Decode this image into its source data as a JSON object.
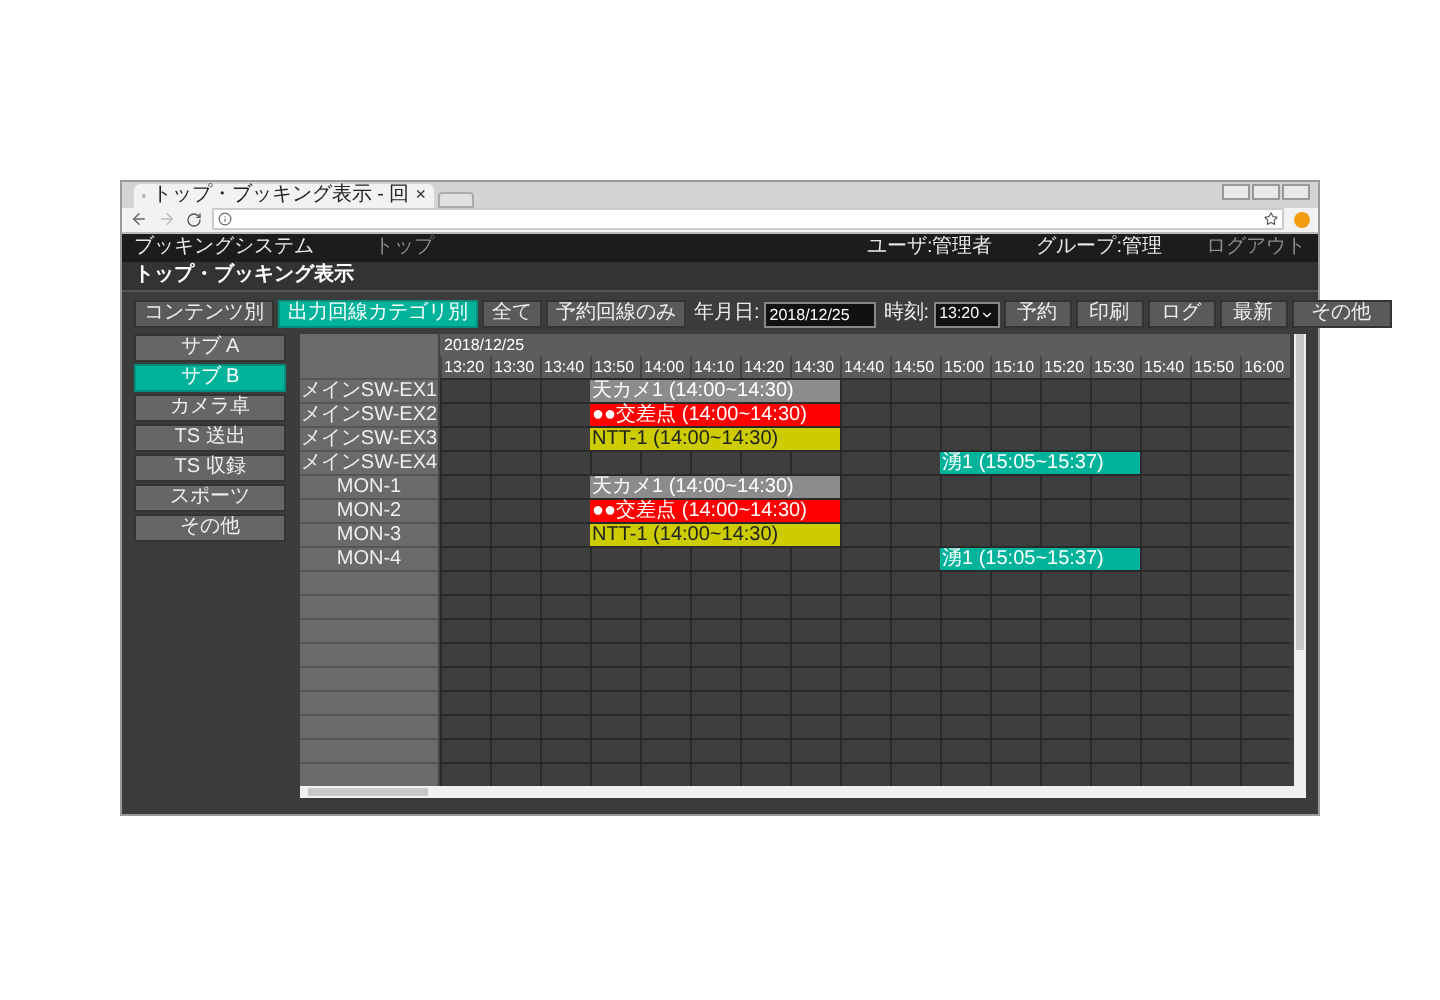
{
  "browser": {
    "tab_title": "トップ・ブッキング表示 - 回",
    "tab_close": "×"
  },
  "nav": {
    "app_name": "ブッキングシステム",
    "link": "トップ",
    "user": "ユーザ:管理者",
    "group": "グループ:管理",
    "logout": "ログアウト"
  },
  "page_title": "トップ・ブッキング表示",
  "toolbar": {
    "view_tabs": [
      {
        "label": "コンテンツ別",
        "selected": false
      },
      {
        "label": "出力回線カテゴリ別",
        "selected": true
      },
      {
        "label": "全て",
        "selected": false
      },
      {
        "label": "予約回線のみ",
        "selected": false
      }
    ],
    "date_label": "年月日:",
    "date_value": "2018/12/25",
    "time_label": "時刻:",
    "time_value": "13:20",
    "actions": [
      "予約",
      "印刷",
      "ログ",
      "最新",
      "その他"
    ]
  },
  "sidebar": {
    "items": [
      {
        "label": "サブ A",
        "selected": false
      },
      {
        "label": "サブ B",
        "selected": true
      },
      {
        "label": "カメラ卓",
        "selected": false
      },
      {
        "label": "TS 送出",
        "selected": false
      },
      {
        "label": "TS 収録",
        "selected": false
      },
      {
        "label": "スポーツ",
        "selected": false
      },
      {
        "label": "その他",
        "selected": false
      }
    ]
  },
  "schedule": {
    "date": "2018/12/25",
    "times": [
      "13:20",
      "13:30",
      "13:40",
      "13:50",
      "14:00",
      "14:10",
      "14:20",
      "14:30",
      "14:40",
      "14:50",
      "15:00",
      "15:10",
      "15:20",
      "15:30",
      "15:40",
      "15:50",
      "16:00"
    ],
    "rows": [
      {
        "name": "メインSW-EX1",
        "events": [
          {
            "title": "天カメ1 (14:00~14:30)",
            "color": "#8c8c8c"
          }
        ],
        "slots": [
          {
            "kind": "free"
          },
          {
            "kind": "free"
          },
          {
            "kind": "free"
          },
          {
            "kind": "booked"
          },
          {
            "kind": "booked"
          },
          {
            "kind": "booked"
          },
          {
            "kind": "booked"
          },
          {
            "kind": "booked"
          },
          {
            "kind": "free"
          },
          {
            "kind": "free"
          },
          {
            "kind": "free"
          },
          {
            "kind": "free"
          },
          {
            "kind": "free"
          },
          {
            "kind": "free"
          },
          {
            "kind": "free"
          },
          {
            "kind": "free"
          },
          {
            "kind": "free"
          }
        ]
      },
      {
        "name": "メインSW-EX2",
        "events": [
          {
            "title": "●●交差点 (14:00~14:30)",
            "color": "#ff0000"
          }
        ],
        "slots": [
          {
            "kind": "free"
          },
          {
            "kind": "free"
          },
          {
            "kind": "free"
          },
          {
            "kind": "booked"
          },
          {
            "kind": "booked"
          },
          {
            "kind": "booked"
          },
          {
            "kind": "booked"
          },
          {
            "kind": "booked"
          },
          {
            "kind": "free"
          },
          {
            "kind": "free"
          },
          {
            "kind": "free"
          },
          {
            "kind": "free"
          },
          {
            "kind": "free"
          },
          {
            "kind": "free"
          },
          {
            "kind": "free"
          },
          {
            "kind": "free"
          },
          {
            "kind": "free"
          }
        ]
      },
      {
        "name": "メインSW-EX3",
        "events": [
          {
            "title": "NTT-1 (14:00~14:30)",
            "color": "#cccc00"
          }
        ],
        "slots": [
          {
            "kind": "free"
          },
          {
            "kind": "free"
          },
          {
            "kind": "free"
          },
          {
            "kind": "booked"
          },
          {
            "kind": "booked"
          },
          {
            "kind": "booked"
          },
          {
            "kind": "booked"
          },
          {
            "kind": "booked"
          },
          {
            "kind": "free"
          },
          {
            "kind": "free"
          },
          {
            "kind": "free"
          },
          {
            "kind": "free"
          },
          {
            "kind": "free"
          },
          {
            "kind": "free"
          },
          {
            "kind": "free"
          },
          {
            "kind": "free"
          },
          {
            "kind": "free"
          }
        ]
      },
      {
        "name": "メインSW-EX4",
        "events": [
          {
            "title": "湧1 (15:05~15:37)",
            "color": "#00b39a"
          }
        ],
        "slots": [
          {
            "kind": "free"
          },
          {
            "kind": "free"
          },
          {
            "kind": "free"
          },
          {
            "kind": "free"
          },
          {
            "kind": "free"
          },
          {
            "kind": "free"
          },
          {
            "kind": "free"
          },
          {
            "kind": "free"
          },
          {
            "kind": "free"
          },
          {
            "kind": "free"
          },
          {
            "kind": "booked"
          },
          {
            "kind": "booked"
          },
          {
            "kind": "booked"
          },
          {
            "kind": "booked"
          },
          {
            "kind": "free"
          },
          {
            "kind": "free"
          },
          {
            "kind": "free"
          }
        ]
      },
      {
        "name": "MON-1",
        "events": [
          {
            "title": "天カメ1 (14:00~14:30)",
            "color": "#8c8c8c"
          }
        ],
        "slots": [
          {
            "kind": "free"
          },
          {
            "kind": "free"
          },
          {
            "kind": "free"
          },
          {
            "kind": "booked"
          },
          {
            "kind": "booked"
          },
          {
            "kind": "booked"
          },
          {
            "kind": "booked"
          },
          {
            "kind": "booked"
          },
          {
            "kind": "free"
          },
          {
            "kind": "free"
          },
          {
            "kind": "free"
          },
          {
            "kind": "free"
          },
          {
            "kind": "free"
          },
          {
            "kind": "free"
          },
          {
            "kind": "free"
          },
          {
            "kind": "free"
          },
          {
            "kind": "free"
          }
        ]
      },
      {
        "name": "MON-2",
        "events": [
          {
            "title": "●●交差点 (14:00~14:30)",
            "color": "#ff0000"
          }
        ],
        "slots": [
          {
            "kind": "free"
          },
          {
            "kind": "free"
          },
          {
            "kind": "free"
          },
          {
            "kind": "booked"
          },
          {
            "kind": "booked"
          },
          {
            "kind": "booked"
          },
          {
            "kind": "booked"
          },
          {
            "kind": "booked"
          },
          {
            "kind": "free"
          },
          {
            "kind": "free"
          },
          {
            "kind": "free"
          },
          {
            "kind": "free"
          },
          {
            "kind": "free"
          },
          {
            "kind": "free"
          },
          {
            "kind": "free"
          },
          {
            "kind": "free"
          },
          {
            "kind": "free"
          }
        ]
      },
      {
        "name": "MON-3",
        "events": [
          {
            "title": "NTT-1 (14:00~14:30)",
            "color": "#cccc00"
          }
        ],
        "slots": [
          {
            "kind": "free"
          },
          {
            "kind": "free"
          },
          {
            "kind": "free"
          },
          {
            "kind": "booked"
          },
          {
            "kind": "booked"
          },
          {
            "kind": "booked"
          },
          {
            "kind": "booked"
          },
          {
            "kind": "booked"
          },
          {
            "kind": "free"
          },
          {
            "kind": "free"
          },
          {
            "kind": "free"
          },
          {
            "kind": "free"
          },
          {
            "kind": "free"
          },
          {
            "kind": "free"
          },
          {
            "kind": "free"
          },
          {
            "kind": "free"
          },
          {
            "kind": "free"
          }
        ]
      },
      {
        "name": "MON-4",
        "events": [
          {
            "title": "湧1 (15:05~15:37)",
            "color": "#00b39a"
          }
        ],
        "slots": [
          {
            "kind": "free"
          },
          {
            "kind": "free"
          },
          {
            "kind": "free"
          },
          {
            "kind": "free"
          },
          {
            "kind": "free"
          },
          {
            "kind": "free"
          },
          {
            "kind": "free"
          },
          {
            "kind": "free"
          },
          {
            "kind": "free"
          },
          {
            "kind": "free"
          },
          {
            "kind": "booked"
          },
          {
            "kind": "booked"
          },
          {
            "kind": "booked"
          },
          {
            "kind": "booked"
          },
          {
            "kind": "free"
          },
          {
            "kind": "free"
          },
          {
            "kind": "free"
          }
        ]
      }
    ]
  }
}
